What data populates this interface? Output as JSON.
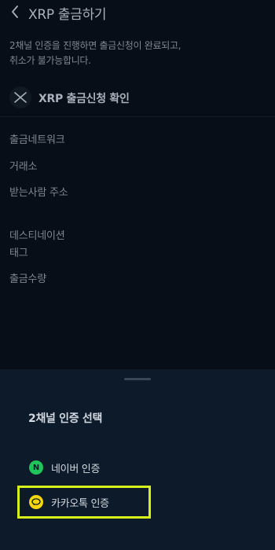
{
  "header": {
    "title": "XRP 출금하기",
    "back_icon": "chevron-left-icon"
  },
  "notice": {
    "line1": "2채널 인증을 진행하면 출금신청이 완료되고,",
    "line2": "취소가 불가능합니다."
  },
  "confirm": {
    "label": "XRP 출금신청 확인",
    "icon": "xrp-logo-icon"
  },
  "fields": {
    "network": "출금네트워크",
    "exchange": "거래소",
    "recipient_address": "받는사람 주소",
    "destination_line1": "데스티네이션",
    "destination_line2": "태그",
    "amount": "출금수량"
  },
  "sheet": {
    "title": "2채널 인증 선택",
    "options": [
      {
        "label": "네이버 인증",
        "icon": "naver-icon",
        "icon_text": "N",
        "color": "#21c45a"
      },
      {
        "label": "카카오톡 인증",
        "icon": "kakaotalk-icon",
        "color": "#f5d60b"
      }
    ],
    "highlight_color": "#d7ef1b"
  }
}
